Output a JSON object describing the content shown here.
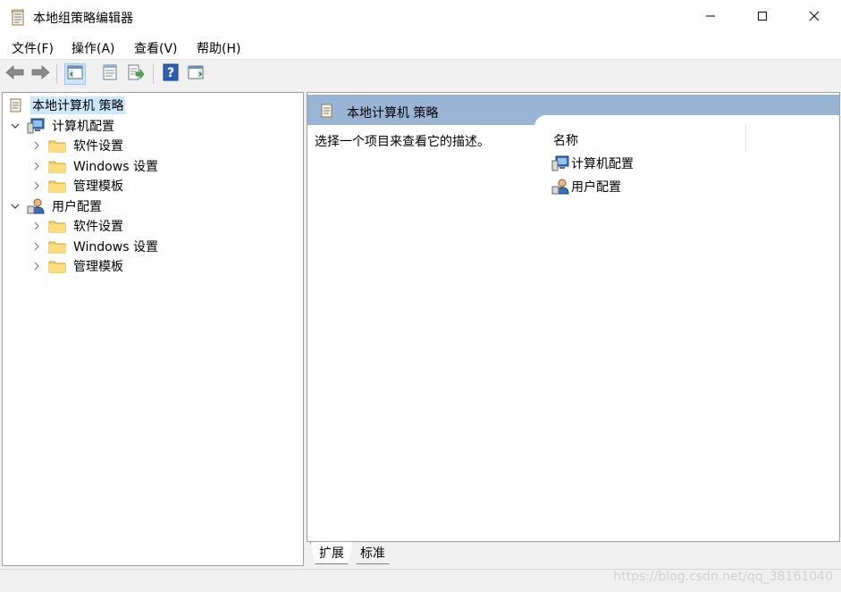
{
  "window": {
    "title": "本地组策略编辑器",
    "icon": "policy-document-icon"
  },
  "menu": {
    "items": [
      {
        "label": "文件(F)"
      },
      {
        "label": "操作(A)"
      },
      {
        "label": "查看(V)"
      },
      {
        "label": "帮助(H)"
      }
    ]
  },
  "toolbar": {
    "buttons": [
      "back-arrow-icon",
      "forward-arrow-icon",
      "show-hide-console-tree-icon",
      "properties-icon",
      "export-list-icon",
      "help-icon",
      "show-hide-action-pane-icon"
    ]
  },
  "tree": {
    "root": "本地计算机 策略",
    "computer": {
      "label": "计算机配置",
      "children": [
        "软件设置",
        "Windows 设置",
        "管理模板"
      ]
    },
    "user": {
      "label": "用户配置",
      "children": [
        "软件设置",
        "Windows 设置",
        "管理模板"
      ]
    }
  },
  "details": {
    "title": "本地计算机 策略",
    "description": "选择一个项目来查看它的描述。",
    "column_name": "名称",
    "items": [
      "计算机配置",
      "用户配置"
    ]
  },
  "tabs": {
    "expand": "扩展",
    "standard": "标准"
  },
  "watermark": "https://blog.csdn.net/qq_38161040",
  "colors": {
    "header_band": "#9ab4d4",
    "selection": "#cce8ff",
    "folder": "#f5cf63"
  }
}
